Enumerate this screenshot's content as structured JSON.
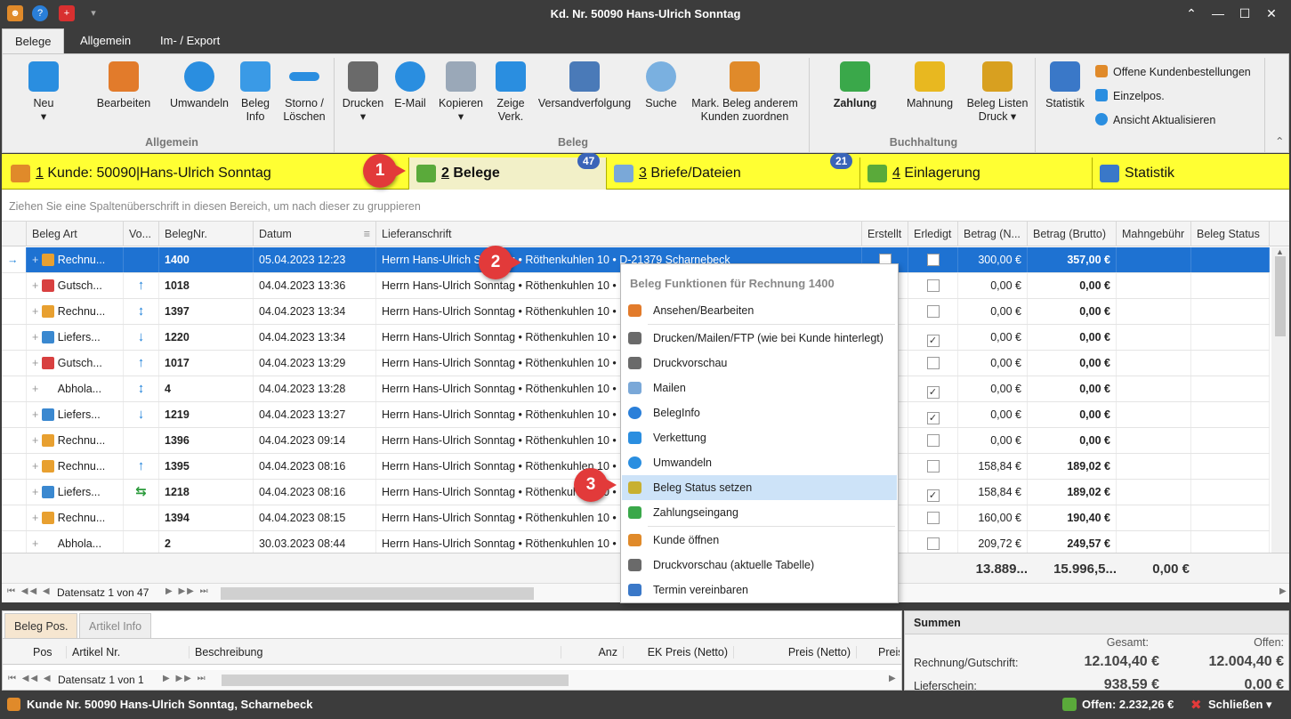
{
  "window": {
    "title": "Kd. Nr. 50090 Hans-Ulrich Sonntag"
  },
  "ribbon_tabs": [
    "Belege",
    "Allgemein",
    "Im- / Export"
  ],
  "ribbon": {
    "allgemein": {
      "neu": "Neu",
      "bearbeiten": "Bearbeiten",
      "umwandeln": "Umwandeln",
      "beleg_info_1": "Beleg",
      "beleg_info_2": "Info",
      "storno_1": "Storno /",
      "storno_2": "Löschen",
      "group": "Allgemein"
    },
    "beleg": {
      "drucken": "Drucken",
      "email": "E-Mail",
      "kopieren": "Kopieren",
      "zeige_1": "Zeige",
      "zeige_2": "Verk.",
      "versand": "Versandverfolgung",
      "suche": "Suche",
      "mark_1": "Mark. Beleg  anderem",
      "mark_2": "Kunden zuordnen",
      "group": "Beleg"
    },
    "buchhaltung": {
      "zahlung": "Zahlung",
      "mahnung": "Mahnung",
      "listen_1": "Beleg Listen",
      "listen_2": "Druck",
      "group": "Buchhaltung"
    },
    "statistik": "Statistik",
    "side": [
      "Offene Kundenbestellungen",
      "Einzelpos.",
      "Ansicht Aktualisieren"
    ]
  },
  "main_tabs": [
    {
      "num": "1",
      "label": " Kunde: 50090|Hans-Ulrich Sonntag"
    },
    {
      "num": "2",
      "label": " Belege",
      "badge": "47"
    },
    {
      "num": "3",
      "label": " Briefe/Dateien",
      "badge": "21"
    },
    {
      "num": "4",
      "label": " Einlagerung"
    },
    {
      "num": "",
      "label": "Statistik"
    }
  ],
  "group_hint": "Ziehen Sie eine Spaltenüberschrift in diesen Bereich, um nach dieser zu gruppieren",
  "columns": [
    "Beleg Art",
    "Vo...",
    "BelegNr.",
    "Datum",
    "Lieferanschrift",
    "Erstellt",
    "Erledigt",
    "Betrag (N...",
    "Betrag (Brutto)",
    "Mahngebühr",
    "Beleg Status"
  ],
  "rows": [
    {
      "art": "Rechnu...",
      "vo": "",
      "nr": "1400",
      "datum": "05.04.2023 12:23",
      "adr": "Herrn Hans-Ulrich Sonntag • Röthenkuhlen 10 • D-21379 Scharnebeck",
      "erstellt": false,
      "erledigt": false,
      "netto": "300,00 €",
      "brutto": "357,00 €"
    },
    {
      "art": "Gutsch...",
      "vo": "↑",
      "nr": "1018",
      "datum": "04.04.2023 13:36",
      "adr": "Herrn Hans-Ulrich Sonntag • Röthenkuhlen 10 •",
      "erstellt": false,
      "erledigt": false,
      "netto": "0,00 €",
      "brutto": "0,00 €"
    },
    {
      "art": "Rechnu...",
      "vo": "↕",
      "nr": "1397",
      "datum": "04.04.2023 13:34",
      "adr": "Herrn Hans-Ulrich Sonntag • Röthenkuhlen 10 •",
      "erstellt": false,
      "erledigt": false,
      "netto": "0,00 €",
      "brutto": "0,00 €"
    },
    {
      "art": "Liefers...",
      "vo": "↓",
      "nr": "1220",
      "datum": "04.04.2023 13:34",
      "adr": "Herrn Hans-Ulrich Sonntag • Röthenkuhlen 10 •",
      "erstellt": false,
      "erledigt": true,
      "netto": "0,00 €",
      "brutto": "0,00 €"
    },
    {
      "art": "Gutsch...",
      "vo": "↑",
      "nr": "1017",
      "datum": "04.04.2023 13:29",
      "adr": "Herrn Hans-Ulrich Sonntag • Röthenkuhlen 10 •",
      "erstellt": false,
      "erledigt": false,
      "netto": "0,00 €",
      "brutto": "0,00 €"
    },
    {
      "art": "Abhola...",
      "vo": "↕",
      "nr": "4",
      "datum": "04.04.2023 13:28",
      "adr": "Herrn Hans-Ulrich Sonntag • Röthenkuhlen 10 •",
      "erstellt": false,
      "erledigt": true,
      "netto": "0,00 €",
      "brutto": "0,00 €"
    },
    {
      "art": "Liefers...",
      "vo": "↓",
      "nr": "1219",
      "datum": "04.04.2023 13:27",
      "adr": "Herrn Hans-Ulrich Sonntag • Röthenkuhlen 10 •",
      "erstellt": false,
      "erledigt": true,
      "netto": "0,00 €",
      "brutto": "0,00 €"
    },
    {
      "art": "Rechnu...",
      "vo": "",
      "nr": "1396",
      "datum": "04.04.2023 09:14",
      "adr": "Herrn Hans-Ulrich Sonntag • Röthenkuhlen 10 •",
      "erstellt": false,
      "erledigt": false,
      "netto": "0,00 €",
      "brutto": "0,00 €"
    },
    {
      "art": "Rechnu...",
      "vo": "↑",
      "nr": "1395",
      "datum": "04.04.2023 08:16",
      "adr": "Herrn Hans-Ulrich Sonntag • Röthenkuhlen 10 •",
      "erstellt": false,
      "erledigt": false,
      "netto": "158,84 €",
      "brutto": "189,02 €"
    },
    {
      "art": "Liefers...",
      "vo": "⇆",
      "nr": "1218",
      "datum": "04.04.2023 08:16",
      "adr": "Herrn Hans-Ulrich Sonntag • Röthenkuhlen 10 •",
      "erstellt": false,
      "erledigt": true,
      "netto": "158,84 €",
      "brutto": "189,02 €"
    },
    {
      "art": "Rechnu...",
      "vo": "",
      "nr": "1394",
      "datum": "04.04.2023 08:15",
      "adr": "Herrn Hans-Ulrich Sonntag • Röthenkuhlen 10 •",
      "erstellt": false,
      "erledigt": false,
      "netto": "160,00 €",
      "brutto": "190,40 €"
    },
    {
      "art": "Abhola...",
      "vo": "",
      "nr": "2",
      "datum": "30.03.2023 08:44",
      "adr": "Herrn Hans-Ulrich Sonntag • Röthenkuhlen 10 •",
      "erstellt": false,
      "erledigt": false,
      "netto": "209,72 €",
      "brutto": "249,57 €"
    }
  ],
  "totals": {
    "netto": "13.889...",
    "brutto": "15.996,5...",
    "mahn": "0,00 €"
  },
  "nav": {
    "record": "Datensatz 1 von 47",
    "record_lower": "Datensatz 1 von 1"
  },
  "context_menu": {
    "title": "Beleg Funktionen für Rechnung 1400",
    "items": [
      "Ansehen/Bearbeiten",
      "Drucken/Mailen/FTP (wie bei Kunde hinterlegt)",
      "Druckvorschau",
      "Mailen",
      "BelegInfo",
      "Verkettung",
      "Umwandeln",
      "Beleg Status setzen",
      "Zahlungseingang",
      "Kunde öffnen",
      "Druckvorschau (aktuelle Tabelle)",
      "Termin vereinbaren"
    ]
  },
  "lower_tabs": [
    "Beleg Pos.",
    "Artikel Info"
  ],
  "lower_columns": [
    "Pos",
    "Artikel Nr.",
    "Beschreibung",
    "Anz",
    "EK Preis (Netto)",
    "Preis (Netto)",
    "Preis"
  ],
  "summen": {
    "title": "Summen",
    "gesamt": "Gesamt:",
    "offen": "Offen:",
    "row1_label": "Rechnung/Gutschrift:",
    "row1_gesamt": "12.104,40 €",
    "row1_offen": "12.004,40 €",
    "row2_label": "Lieferschein:",
    "row2_gesamt": "938,59 €",
    "row2_offen": "0,00 €"
  },
  "status": {
    "left": "Kunde Nr. 50090 Hans-Ulrich Sonntag, Scharnebeck",
    "offen": "Offen: 2.232,26 €",
    "close": "Schließen"
  },
  "callouts": [
    "1",
    "2",
    "3"
  ],
  "colors": {
    "accent": "#1e72d2",
    "tab_yellow": "#ffff33",
    "callout": "#e23a3a"
  }
}
